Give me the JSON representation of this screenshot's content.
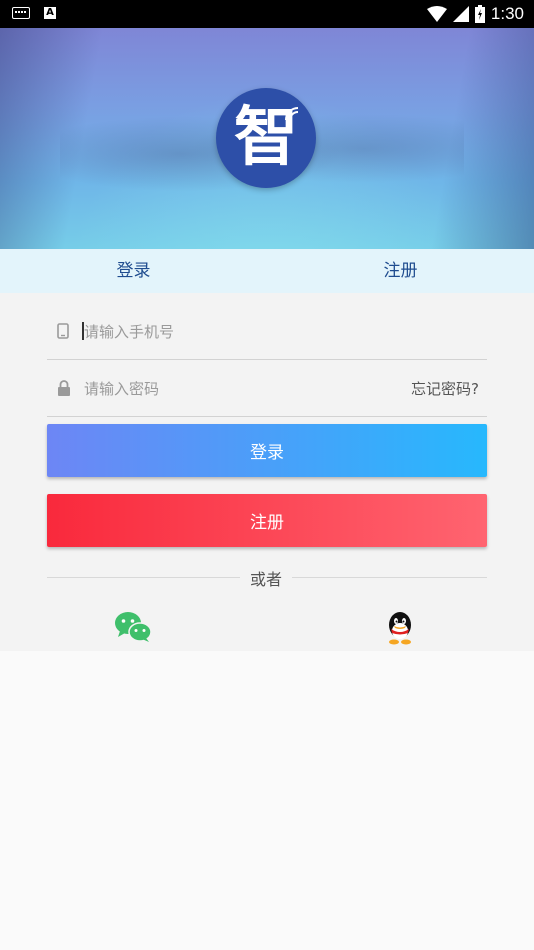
{
  "status_bar": {
    "time": "1:30"
  },
  "header": {
    "logo_char": "智"
  },
  "tabs": [
    {
      "label": "登录",
      "active": true
    },
    {
      "label": "注册",
      "active": false
    }
  ],
  "form": {
    "phone_placeholder": "请输入手机号",
    "password_placeholder": "请输入密码",
    "forgot_label": "忘记密码?",
    "login_label": "登录",
    "register_label": "注册",
    "divider_text": "或者"
  },
  "social": [
    {
      "icon": "wechat-icon"
    },
    {
      "icon": "qq-icon"
    }
  ],
  "colors": {
    "tab_text": "#1f4c8f",
    "login_gradient": [
      "#6d86f5",
      "#27b8fd"
    ],
    "register_gradient": [
      "#f9293c",
      "#ff6470"
    ],
    "wechat_green": "#3fbf6b",
    "logo_blue": "#2d4fa8"
  }
}
